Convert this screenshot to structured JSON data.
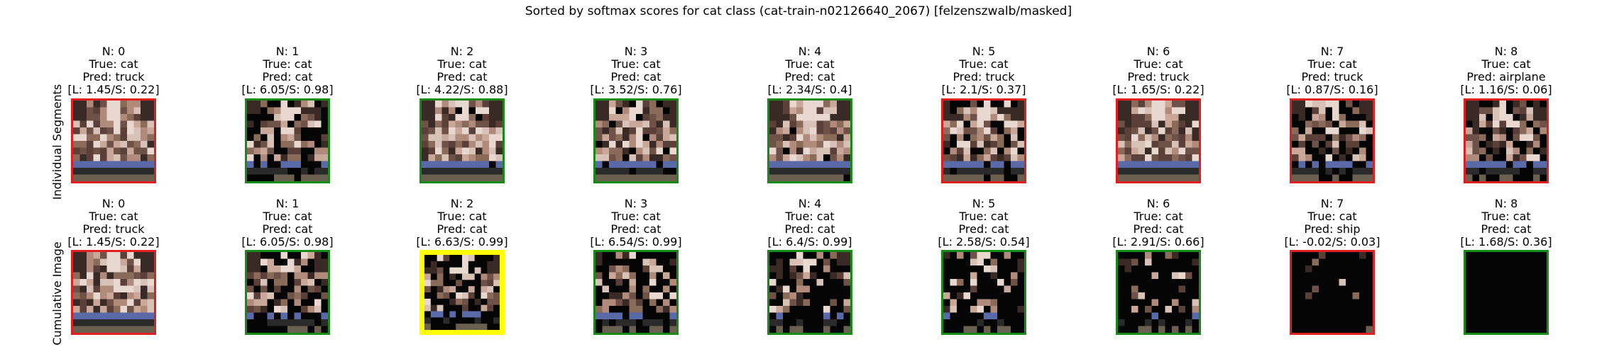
{
  "figure": {
    "title": "Sorted by softmax scores for cat class (cat-train-n02126640_2067) [felzenszwalb/masked]"
  },
  "rows": [
    {
      "label": "Individual Segments"
    },
    {
      "label": "Cumulative Image"
    }
  ],
  "status_colors": {
    "correct": "#178a17",
    "wrong": "#e02020",
    "best": "#ffff00"
  },
  "chart_data": [
    {
      "type": "image-grid",
      "row": "Individual Segments",
      "panels": [
        {
          "n": 0,
          "true": "cat",
          "pred": "truck",
          "logit": 1.45,
          "softmax": 0.22,
          "border": "wrong",
          "visible_fraction": 1.0,
          "line1": "N: 0",
          "line2": "True: cat",
          "line3": "Pred: truck",
          "line4": "[L: 1.45/S: 0.22]"
        },
        {
          "n": 1,
          "true": "cat",
          "pred": "cat",
          "logit": 6.05,
          "softmax": 0.98,
          "border": "correct",
          "visible_fraction": 0.6,
          "line1": "N: 1",
          "line2": "True: cat",
          "line3": "Pred: cat",
          "line4": "[L: 6.05/S: 0.98]"
        },
        {
          "n": 2,
          "true": "cat",
          "pred": "cat",
          "logit": 4.22,
          "softmax": 0.88,
          "border": "correct",
          "visible_fraction": 0.95,
          "line1": "N: 2",
          "line2": "True: cat",
          "line3": "Pred: cat",
          "line4": "[L: 4.22/S: 0.88]"
        },
        {
          "n": 3,
          "true": "cat",
          "pred": "cat",
          "logit": 3.52,
          "softmax": 0.76,
          "border": "correct",
          "visible_fraction": 0.85,
          "line1": "N: 3",
          "line2": "True: cat",
          "line3": "Pred: cat",
          "line4": "[L: 3.52/S: 0.76]"
        },
        {
          "n": 4,
          "true": "cat",
          "pred": "cat",
          "logit": 2.34,
          "softmax": 0.4,
          "border": "correct",
          "visible_fraction": 0.95,
          "line1": "N: 4",
          "line2": "True: cat",
          "line3": "Pred: cat",
          "line4": "[L: 2.34/S: 0.4]"
        },
        {
          "n": 5,
          "true": "cat",
          "pred": "truck",
          "logit": 2.1,
          "softmax": 0.37,
          "border": "wrong",
          "visible_fraction": 0.8,
          "line1": "N: 5",
          "line2": "True: cat",
          "line3": "Pred: truck",
          "line4": "[L: 2.1/S: 0.37]"
        },
        {
          "n": 6,
          "true": "cat",
          "pred": "truck",
          "logit": 1.65,
          "softmax": 0.22,
          "border": "wrong",
          "visible_fraction": 1.0,
          "line1": "N: 6",
          "line2": "True: cat",
          "line3": "Pred: truck",
          "line4": "[L: 1.65/S: 0.22]"
        },
        {
          "n": 7,
          "true": "cat",
          "pred": "truck",
          "logit": 0.87,
          "softmax": 0.16,
          "border": "wrong",
          "visible_fraction": 0.7,
          "line1": "N: 7",
          "line2": "True: cat",
          "line3": "Pred: truck",
          "line4": "[L: 0.87/S: 0.16]"
        },
        {
          "n": 8,
          "true": "cat",
          "pred": "airplane",
          "logit": 1.16,
          "softmax": 0.06,
          "border": "wrong",
          "visible_fraction": 0.75,
          "line1": "N: 8",
          "line2": "True: cat",
          "line3": "Pred: airplane",
          "line4": "[L: 1.16/S: 0.06]"
        }
      ]
    },
    {
      "type": "image-grid",
      "row": "Cumulative Image",
      "panels": [
        {
          "n": 0,
          "true": "cat",
          "pred": "truck",
          "logit": 1.45,
          "softmax": 0.22,
          "border": "wrong",
          "visible_fraction": 1.0,
          "line1": "N: 0",
          "line2": "True: cat",
          "line3": "Pred: truck",
          "line4": "[L: 1.45/S: 0.22]"
        },
        {
          "n": 1,
          "true": "cat",
          "pred": "cat",
          "logit": 6.05,
          "softmax": 0.98,
          "border": "correct",
          "visible_fraction": 0.6,
          "line1": "N: 1",
          "line2": "True: cat",
          "line3": "Pred: cat",
          "line4": "[L: 6.05/S: 0.98]"
        },
        {
          "n": 2,
          "true": "cat",
          "pred": "cat",
          "logit": 6.63,
          "softmax": 0.99,
          "border": "best",
          "visible_fraction": 0.55,
          "line1": "N: 2",
          "line2": "True: cat",
          "line3": "Pred: cat",
          "line4": "[L: 6.63/S: 0.99]"
        },
        {
          "n": 3,
          "true": "cat",
          "pred": "cat",
          "logit": 6.54,
          "softmax": 0.99,
          "border": "correct",
          "visible_fraction": 0.5,
          "line1": "N: 3",
          "line2": "True: cat",
          "line3": "Pred: cat",
          "line4": "[L: 6.54/S: 0.99]"
        },
        {
          "n": 4,
          "true": "cat",
          "pred": "cat",
          "logit": 6.4,
          "softmax": 0.99,
          "border": "correct",
          "visible_fraction": 0.4,
          "line1": "N: 4",
          "line2": "True: cat",
          "line3": "Pred: cat",
          "line4": "[L: 6.4/S: 0.99]"
        },
        {
          "n": 5,
          "true": "cat",
          "pred": "cat",
          "logit": 2.58,
          "softmax": 0.54,
          "border": "correct",
          "visible_fraction": 0.3,
          "line1": "N: 5",
          "line2": "True: cat",
          "line3": "Pred: cat",
          "line4": "[L: 2.58/S: 0.54]"
        },
        {
          "n": 6,
          "true": "cat",
          "pred": "cat",
          "logit": 2.91,
          "softmax": 0.66,
          "border": "correct",
          "visible_fraction": 0.25,
          "line1": "N: 6",
          "line2": "True: cat",
          "line3": "Pred: cat",
          "line4": "[L: 2.91/S: 0.66]"
        },
        {
          "n": 7,
          "true": "cat",
          "pred": "ship",
          "logit": -0.02,
          "softmax": 0.03,
          "border": "wrong",
          "visible_fraction": 0.05,
          "line1": "N: 7",
          "line2": "True: cat",
          "line3": "Pred: ship",
          "line4": "[L: -0.02/S: 0.03]"
        },
        {
          "n": 8,
          "true": "cat",
          "pred": "cat",
          "logit": 1.68,
          "softmax": 0.36,
          "border": "correct",
          "visible_fraction": 0.0,
          "line1": "N: 8",
          "line2": "True: cat",
          "line3": "Pred: cat",
          "line4": "[L: 1.68/S: 0.36]"
        }
      ]
    }
  ]
}
